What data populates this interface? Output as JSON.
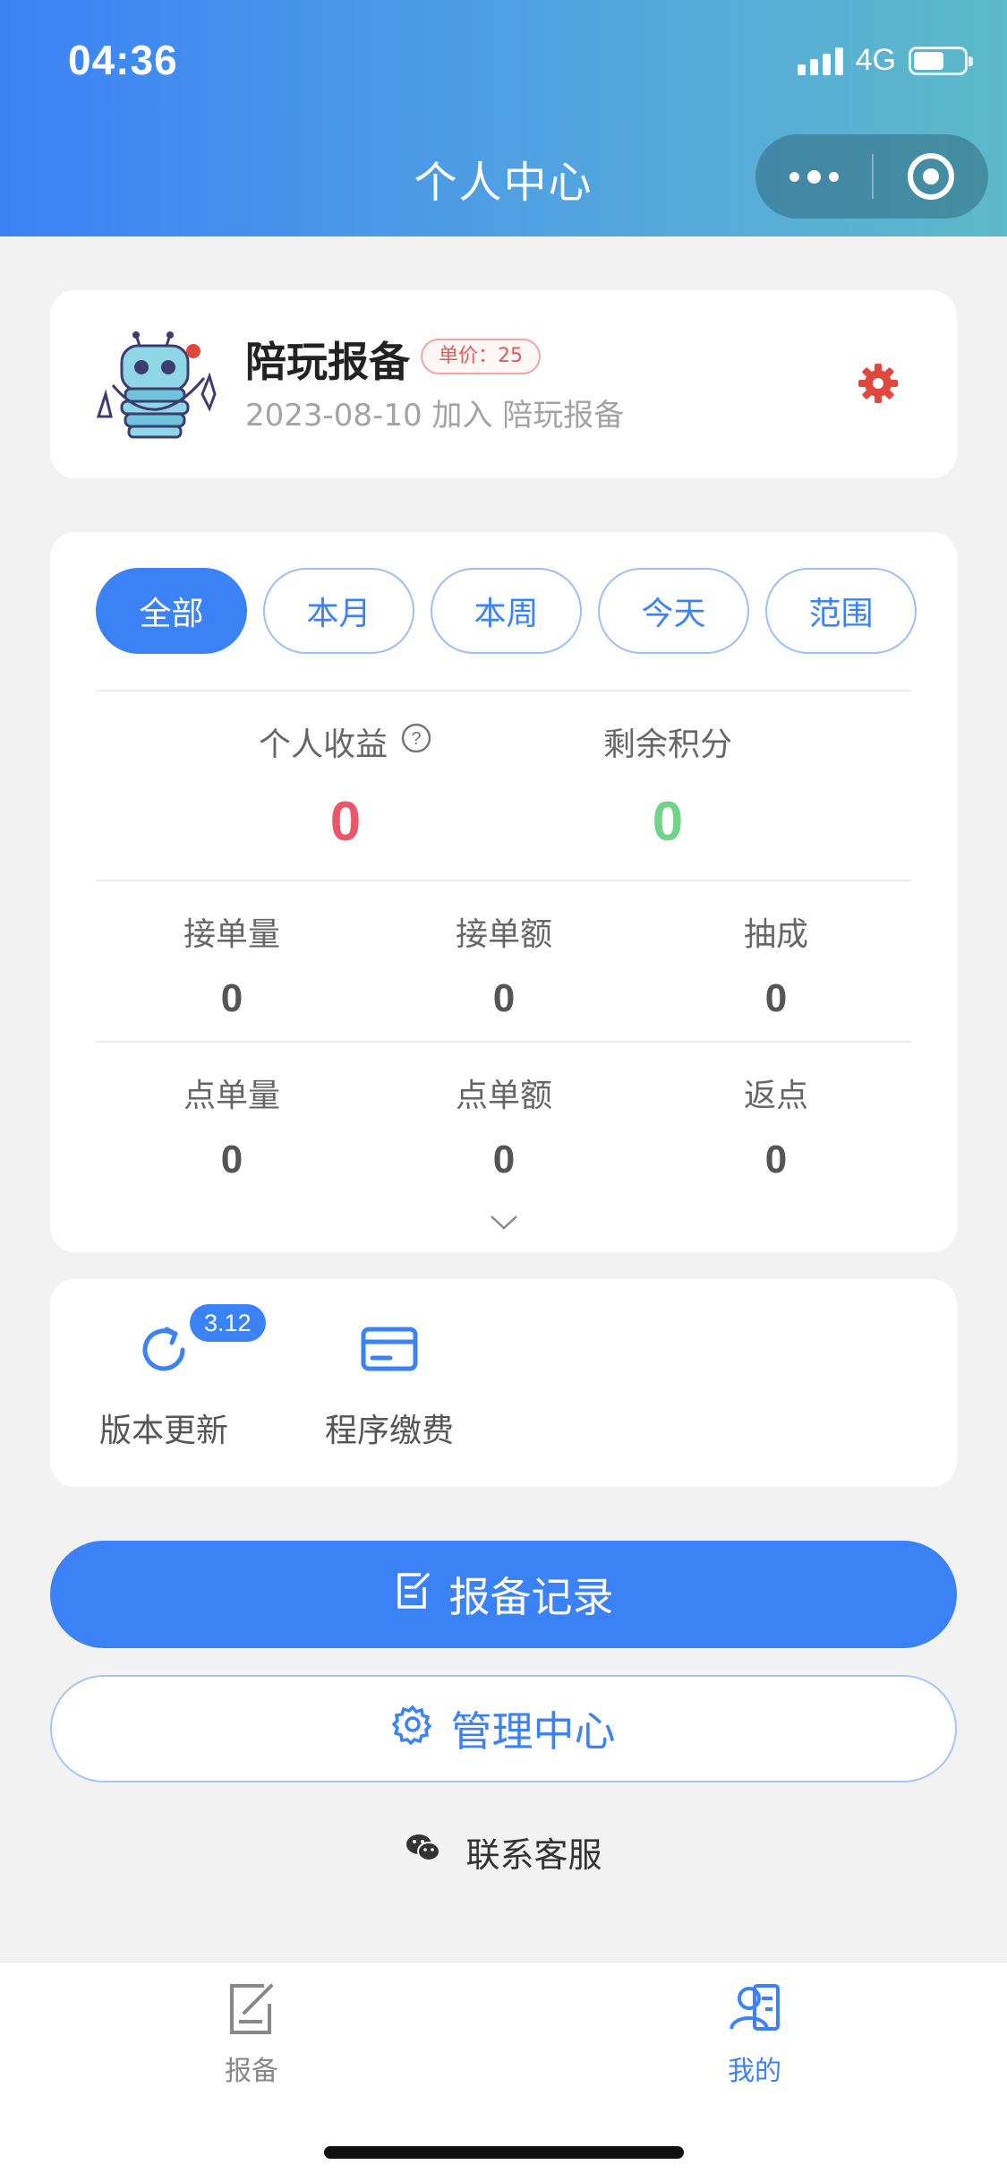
{
  "status_bar": {
    "time": "04:36",
    "network": "4G"
  },
  "nav": {
    "title": "个人中心"
  },
  "profile": {
    "name": "陪玩报备",
    "price_tag": "单价：25",
    "join_info": "2023-08-10 加入 陪玩报备"
  },
  "filter_tabs": [
    {
      "label": "全部",
      "active": true
    },
    {
      "label": "本月",
      "active": false
    },
    {
      "label": "本周",
      "active": false
    },
    {
      "label": "今天",
      "active": false
    },
    {
      "label": "范围",
      "active": false
    }
  ],
  "summary": {
    "income_label": "个人收益",
    "income_value": "0",
    "points_label": "剩余积分",
    "points_value": "0"
  },
  "stats_row1": [
    {
      "label": "接单量",
      "value": "0"
    },
    {
      "label": "接单额",
      "value": "0"
    },
    {
      "label": "抽成",
      "value": "0"
    }
  ],
  "stats_row2": [
    {
      "label": "点单量",
      "value": "0"
    },
    {
      "label": "点单额",
      "value": "0"
    },
    {
      "label": "返点",
      "value": "0"
    }
  ],
  "tools": {
    "update_label": "版本更新",
    "update_badge": "3.12",
    "payment_label": "程序缴费"
  },
  "buttons": {
    "records": "报备记录",
    "admin": "管理中心",
    "contact": "联系客服"
  },
  "tabbar": [
    {
      "label": "报备",
      "active": false
    },
    {
      "label": "我的",
      "active": true
    }
  ],
  "colors": {
    "primary": "#3b82f6",
    "income": "#e9586a",
    "points": "#6fd38a",
    "settings_gear": "#e0483f"
  }
}
